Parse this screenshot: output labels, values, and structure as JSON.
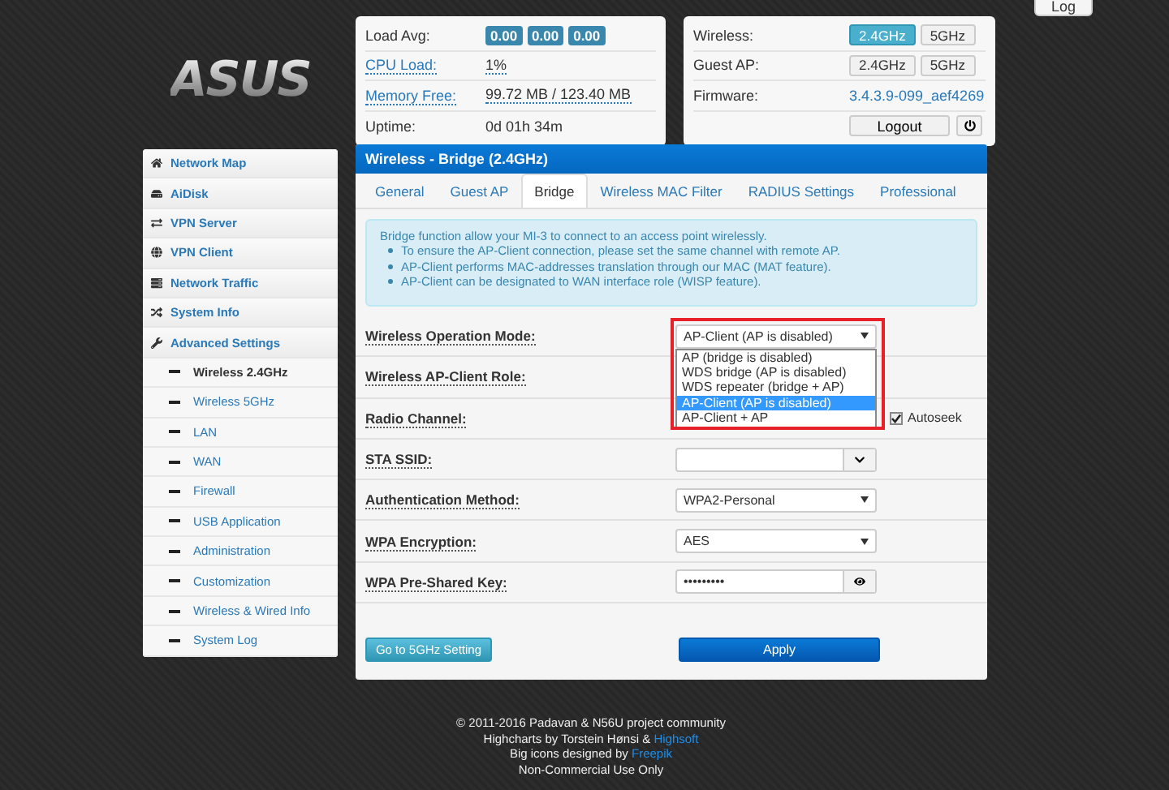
{
  "logo": "ASUS",
  "log_button": "Log",
  "status": {
    "rows": [
      {
        "label": "Load Avg:",
        "kind": "badges",
        "values": [
          "0.00",
          "0.00",
          "0.00"
        ]
      },
      {
        "label": "CPU Load:",
        "kind": "link",
        "value": "1%"
      },
      {
        "label": "Memory Free:",
        "kind": "link",
        "value": "99.72 MB / 123.40 MB"
      },
      {
        "label": "Uptime:",
        "kind": "text",
        "value": "0d 01h 34m"
      }
    ]
  },
  "system": {
    "rows": [
      {
        "label": "Wireless:",
        "kind": "toggles",
        "buttons": [
          {
            "label": "2.4GHz",
            "selected": true
          },
          {
            "label": "5GHz",
            "selected": false
          }
        ]
      },
      {
        "label": "Guest AP:",
        "kind": "toggles",
        "buttons": [
          {
            "label": "2.4GHz",
            "selected": false
          },
          {
            "label": "5GHz",
            "selected": false
          }
        ]
      },
      {
        "label": "Firmware:",
        "kind": "link",
        "value": "3.4.3.9-099_aef4269"
      }
    ],
    "logout": "Logout"
  },
  "sidebar": {
    "items": [
      {
        "label": "Network Map"
      },
      {
        "label": "AiDisk"
      },
      {
        "label": "VPN Server"
      },
      {
        "label": "VPN Client"
      },
      {
        "label": "Network Traffic"
      },
      {
        "label": "System Info"
      },
      {
        "label": "Advanced Settings",
        "children": [
          {
            "label": "Wireless 2.4GHz",
            "selected": true
          },
          {
            "label": "Wireless 5GHz",
            "selected": false
          },
          {
            "label": "LAN",
            "selected": false
          },
          {
            "label": "WAN",
            "selected": false
          },
          {
            "label": "Firewall",
            "selected": false
          },
          {
            "label": "USB Application",
            "selected": false
          },
          {
            "label": "Administration",
            "selected": false
          },
          {
            "label": "Customization",
            "selected": false
          },
          {
            "label": "Wireless & Wired Info",
            "selected": false
          },
          {
            "label": "System Log",
            "selected": false
          }
        ]
      }
    ]
  },
  "panel": {
    "title": "Wireless - Bridge (2.4GHz)",
    "tabs": [
      {
        "label": "General",
        "selected": false
      },
      {
        "label": "Guest AP",
        "selected": false
      },
      {
        "label": "Bridge",
        "selected": true
      },
      {
        "label": "Wireless MAC Filter",
        "selected": false
      },
      {
        "label": "RADIUS Settings",
        "selected": false
      },
      {
        "label": "Professional",
        "selected": false
      }
    ],
    "info": {
      "intro": "Bridge function allow your MI-3 to connect to an access point wirelessly.",
      "bullets": [
        "To ensure the AP-Client connection, please set the same channel with remote AP.",
        "AP-Client performs MAC-addresses translation through our MAC (MAT feature).",
        "AP-Client can be designated to WAN interface role (WISP feature)."
      ]
    },
    "fields": [
      {
        "label": "Wireless Operation Mode:",
        "kind": "select",
        "value": "AP-Client (AP is disabled)",
        "open": true,
        "highlighted": true,
        "options": [
          {
            "label": "AP (bridge is disabled)",
            "selected": false
          },
          {
            "label": "WDS bridge (AP is disabled)",
            "selected": false
          },
          {
            "label": "WDS repeater (bridge + AP)",
            "selected": false
          },
          {
            "label": "AP-Client (AP is disabled)",
            "selected": true
          },
          {
            "label": "AP-Client + AP",
            "selected": false
          }
        ]
      },
      {
        "label": "Wireless AP-Client Role:",
        "kind": "covered"
      },
      {
        "label": "Radio Channel:",
        "kind": "checkbox",
        "checkbox_label": "Autoseek",
        "checked": true
      },
      {
        "label": "STA SSID:",
        "kind": "combo"
      },
      {
        "label": "Authentication Method:",
        "kind": "select",
        "value": "WPA2-Personal"
      },
      {
        "label": "WPA Encryption:",
        "kind": "select",
        "value": "AES"
      },
      {
        "label": "WPA Pre-Shared Key:",
        "kind": "password",
        "value": "•••••••••"
      }
    ],
    "secondary_button": "Go to 5GHz Setting",
    "primary_button": "Apply"
  },
  "footer": [
    {
      "text": "© 2011-2016 Padavan & N56U project community"
    },
    {
      "text": "Highcharts by Torstein Hønsi &",
      "link": "Highsoft"
    },
    {
      "text": "Big icons designed by",
      "link": "Freepik"
    },
    {
      "text": "Non-Commercial Use Only"
    }
  ]
}
